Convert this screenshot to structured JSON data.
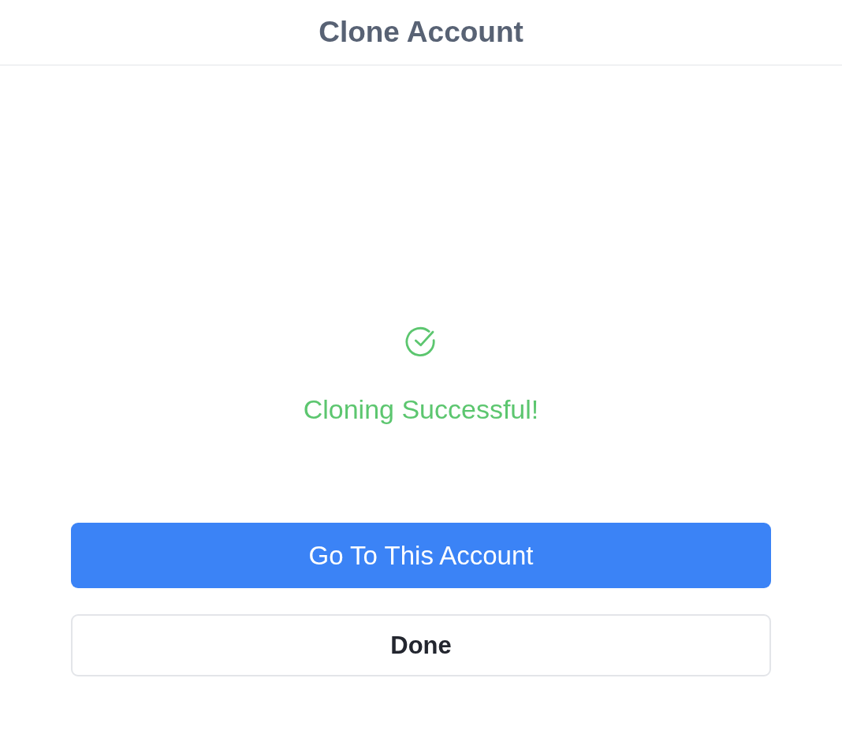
{
  "header": {
    "title": "Clone Account"
  },
  "status": {
    "kind": "success",
    "message": "Cloning Successful!"
  },
  "buttons": [
    {
      "label": "Go To This Account",
      "kind": "primary"
    },
    {
      "label": "Done",
      "kind": "secondary"
    }
  ]
}
